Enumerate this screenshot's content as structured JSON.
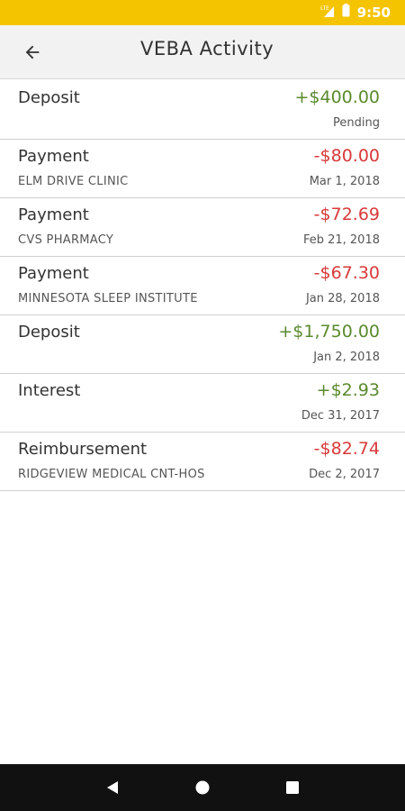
{
  "status_bar": {
    "time": "9:50",
    "network_label": "LTE",
    "colors": {
      "background": "#f5c400"
    }
  },
  "header": {
    "title": "VEBA Activity",
    "back_icon": "arrow-left-icon"
  },
  "colors": {
    "positive": "#5a8a2e",
    "negative": "#d9393a"
  },
  "transactions": [
    {
      "type": "Deposit",
      "amount": "+$400.00",
      "sign": "positive",
      "merchant": "",
      "date": "Pending"
    },
    {
      "type": "Payment",
      "amount": "-$80.00",
      "sign": "negative",
      "merchant": "ELM DRIVE CLINIC",
      "date": "Mar 1, 2018"
    },
    {
      "type": "Payment",
      "amount": "-$72.69",
      "sign": "negative",
      "merchant": "CVS PHARMACY",
      "date": "Feb 21, 2018"
    },
    {
      "type": "Payment",
      "amount": "-$67.30",
      "sign": "negative",
      "merchant": "MINNESOTA SLEEP INSTITUTE",
      "date": "Jan 28, 2018"
    },
    {
      "type": "Deposit",
      "amount": "+$1,750.00",
      "sign": "positive",
      "merchant": "",
      "date": "Jan 2, 2018"
    },
    {
      "type": "Interest",
      "amount": "+$2.93",
      "sign": "positive",
      "merchant": "",
      "date": "Dec 31, 2017"
    },
    {
      "type": "Reimbursement",
      "amount": "-$82.74",
      "sign": "negative",
      "merchant": "RIDGEVIEW MEDICAL CNT-HOS",
      "date": "Dec 2, 2017"
    }
  ],
  "nav_bar": {
    "buttons": [
      "back-triangle-icon",
      "home-circle-icon",
      "recents-square-icon"
    ]
  }
}
